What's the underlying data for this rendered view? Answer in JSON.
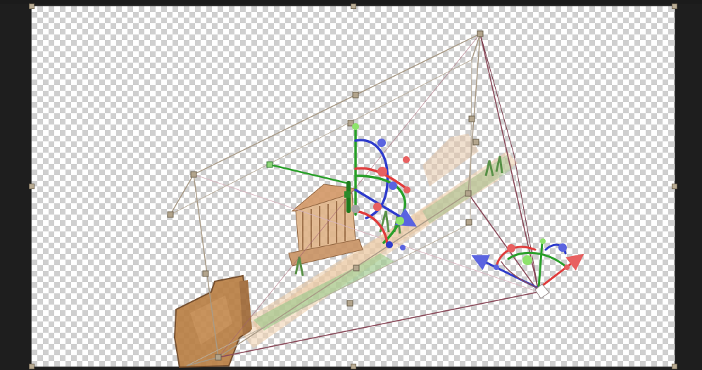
{
  "editor": {
    "view": "3d-camera-transform",
    "canvas_background": "transparency-checkerboard",
    "colors": {
      "frame": "#1e1e1e",
      "bounding_box": "#a89a86",
      "camera_frustum": "#8a4a5a",
      "gizmo_x": "#e03c3c",
      "gizmo_y": "#2aa02a",
      "gizmo_z": "#2f3ccc",
      "handle": "#b9ac94"
    },
    "gizmos": [
      "layer-rotate-gizmo",
      "camera-rotate-gizmo"
    ],
    "artwork": "watercolor-temple-scroll-illustration"
  }
}
